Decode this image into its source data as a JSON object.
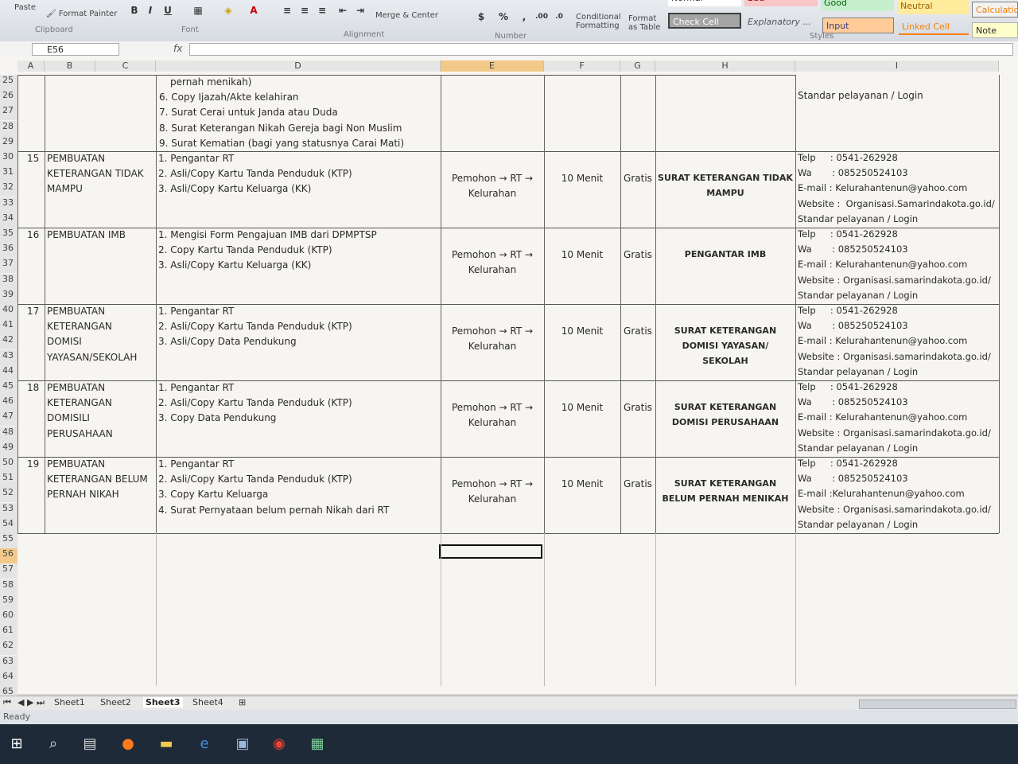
{
  "ribbon": {
    "paste": "Paste",
    "format_painter": "Format Painter",
    "clipboard": "Clipboard",
    "font": "Font",
    "alignment": "Alignment",
    "merge_center": "Merge & Center",
    "number": "Number",
    "conditional": "Conditional",
    "formatting": "Formatting",
    "format": "Format",
    "as_table": "as Table",
    "styles": "Styles",
    "styles_list": {
      "normal": "Normal",
      "bad": "Bad",
      "good": "Good",
      "neutral": "Neutral",
      "calculation": "Calculation",
      "check_cell": "Check Cell",
      "explanatory": "Explanatory ...",
      "input": "Input",
      "linked_cell": "Linked Cell",
      "note": "Note"
    }
  },
  "formula_bar": {
    "name_box": "E56",
    "fx": "fx"
  },
  "columns": [
    "A",
    "B",
    "C",
    "D",
    "E",
    "F",
    "G",
    "H",
    "I"
  ],
  "rows": [
    "25",
    "26",
    "27",
    "28",
    "29",
    "30",
    "31",
    "32",
    "33",
    "34",
    "35",
    "36",
    "37",
    "38",
    "39",
    "40",
    "41",
    "42",
    "43",
    "44",
    "45",
    "46",
    "47",
    "48",
    "49",
    "50",
    "51",
    "52",
    "53",
    "54",
    "55",
    "56",
    "57",
    "58",
    "59",
    "60",
    "61",
    "62",
    "63",
    "64",
    "65"
  ],
  "top": {
    "d": [
      "pernah menikah)",
      "6. Copy Ijazah/Akte kelahiran",
      "7. Surat Cerai untuk Janda atau Duda",
      "8. Surat Keterangan Nikah Gereja bagi Non Muslim",
      "9. Surat Kematian (bagi yang statusnya Carai Mati)"
    ],
    "i": "Standar pelayanan / Login"
  },
  "records": [
    {
      "no": "15",
      "name": [
        "PEMBUATAN",
        "KETERANGAN TIDAK",
        "MAMPU"
      ],
      "reqs": [
        "1. Pengantar RT",
        "2. Asli/Copy Kartu Tanda Penduduk (KTP)",
        "3. Asli/Copy Kartu Keluarga (KK)"
      ],
      "flow": [
        "Pemohon → RT →",
        "Kelurahan"
      ],
      "time": "10 Menit",
      "cost": "Gratis",
      "output": [
        "SURAT KETERANGAN TIDAK",
        "MAMPU"
      ],
      "contact": [
        "Telp     : 0541-262928",
        "Wa       : 085250524103",
        "E-mail : Kelurahantenun@yahoo.com",
        "Website :  Organisasi.Samarindakota.go.id/",
        "Standar pelayanan / Login"
      ]
    },
    {
      "no": "16",
      "name": [
        "PEMBUATAN IMB"
      ],
      "reqs": [
        "1. Mengisi Form Pengajuan IMB dari DPMPTSP",
        "2. Copy Kartu Tanda Penduduk (KTP)",
        "3. Asli/Copy Kartu Keluarga (KK)"
      ],
      "flow": [
        "Pemohon → RT →",
        "Kelurahan"
      ],
      "time": "10 Menit",
      "cost": "Gratis",
      "output": [
        "PENGANTAR IMB"
      ],
      "contact": [
        "Telp     : 0541-262928",
        "Wa       : 085250524103",
        "E-mail : Kelurahantenun@yahoo.com",
        "Website : Organisasi.samarindakota.go.id/",
        "Standar pelayanan / Login"
      ]
    },
    {
      "no": "17",
      "name": [
        "PEMBUATAN",
        "KETERANGAN",
        "DOMISI",
        "YAYASAN/SEKOLAH"
      ],
      "reqs": [
        "1. Pengantar RT",
        "2. Asli/Copy Kartu Tanda Penduduk (KTP)",
        "3. Asli/Copy Data Pendukung"
      ],
      "flow": [
        "Pemohon → RT →",
        "Kelurahan"
      ],
      "time": "10 Menit",
      "cost": "Gratis",
      "output": [
        "SURAT KETERANGAN",
        "DOMISI YAYASAN/",
        "SEKOLAH"
      ],
      "contact": [
        "Telp     : 0541-262928",
        "Wa       : 085250524103",
        "E-mail : Kelurahantenun@yahoo.com",
        "Website : Organisasi.samarindakota.go.id/",
        "Standar pelayanan / Login"
      ]
    },
    {
      "no": "18",
      "name": [
        "PEMBUATAN",
        "KETERANGAN",
        "DOMISILI",
        "PERUSAHAAN"
      ],
      "reqs": [
        "1. Pengantar RT",
        "2. Asli/Copy Kartu Tanda Penduduk (KTP)",
        "3. Copy Data Pendukung"
      ],
      "flow": [
        "Pemohon → RT →",
        "Kelurahan"
      ],
      "time": "10 Menit",
      "cost": "Gratis",
      "output": [
        "SURAT KETERANGAN",
        "DOMISI PERUSAHAAN"
      ],
      "contact": [
        "Telp     : 0541-262928",
        "Wa       : 085250524103",
        "E-mail : Kelurahantenun@yahoo.com",
        "Website : Organisasi.samarindakota.go.id/",
        "Standar pelayanan / Login"
      ]
    },
    {
      "no": "19",
      "name": [
        "PEMBUATAN",
        "KETERANGAN BELUM",
        "PERNAH NIKAH"
      ],
      "reqs": [
        "1. Pengantar RT",
        "2. Asli/Copy Kartu Tanda Penduduk (KTP)",
        "3. Copy Kartu Keluarga",
        "4. Surat Pernyataan belum pernah Nikah dari RT"
      ],
      "flow": [
        "Pemohon → RT →",
        "Kelurahan"
      ],
      "time": "10 Menit",
      "cost": "Gratis",
      "output": [
        "SURAT KETERANGAN",
        "BELUM PERNAH MENIKAH"
      ],
      "contact": [
        "Telp     : 0541-262928",
        "Wa       : 085250524103",
        "E-mail :Kelurahantenun@yahoo.com",
        "Website : Organisasi.samarindakota.go.id/",
        "Standar pelayanan / Login"
      ]
    }
  ],
  "sheet_tabs": [
    "Sheet1",
    "Sheet2",
    "Sheet3",
    "Sheet4"
  ],
  "active_tab": "Sheet3",
  "status": "Ready",
  "taskbar_icons": [
    "windows-icon",
    "search-icon",
    "task-view-icon",
    "firefox-icon",
    "file-explorer-icon",
    "edge-icon",
    "word-icon",
    "chrome-icon",
    "excel-icon"
  ]
}
